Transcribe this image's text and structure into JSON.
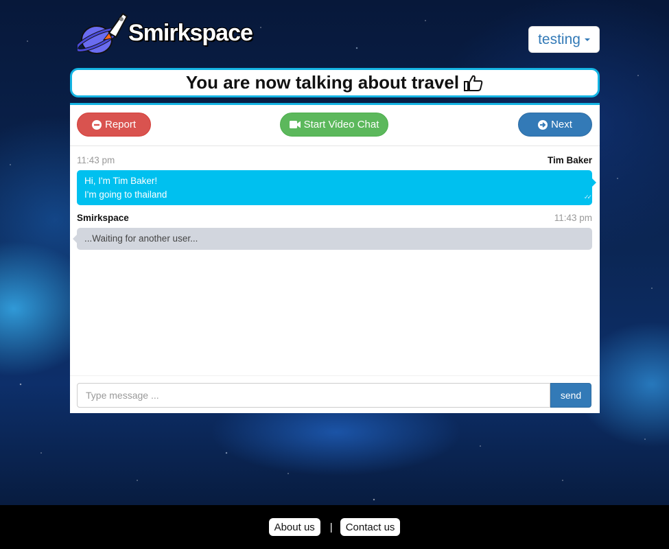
{
  "header": {
    "logo_text": "Smirkspace",
    "user_menu_label": "testing"
  },
  "topic_banner": {
    "text": "You are now talking about travel"
  },
  "toolbar": {
    "report_label": "Report",
    "video_chat_label": "Start Video Chat",
    "next_label": "Next"
  },
  "messages": [
    {
      "author": "Tim Baker",
      "time": "11:43 pm",
      "lines": [
        "Hi, I'm Tim Baker!",
        "I'm going to thailand"
      ]
    },
    {
      "author": "Smirkspace",
      "time": "11:43 pm",
      "lines": [
        "...Waiting for another user..."
      ]
    }
  ],
  "composer": {
    "placeholder": "Type message ...",
    "send_label": "send"
  },
  "footer": {
    "about_label": "About us",
    "separator": "|",
    "contact_label": "Contact us"
  },
  "colors": {
    "accent": "#14b4e3",
    "own_bubble": "#00c0ef",
    "system_bubble": "#d2d6de",
    "report": "#d9534f",
    "video": "#5cb85c",
    "primary": "#337ab7"
  }
}
